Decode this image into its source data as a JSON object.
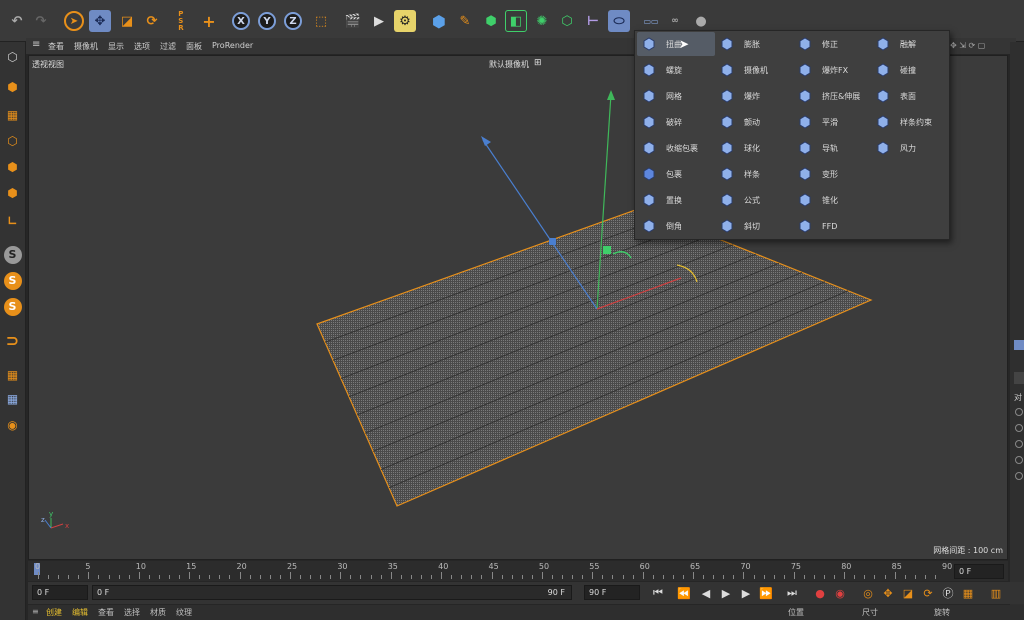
{
  "toolbar": {
    "axis_x": "X",
    "axis_y": "Y",
    "axis_z": "Z"
  },
  "viewport": {
    "menu": [
      "查看",
      "摄像机",
      "显示",
      "选项",
      "过滤",
      "面板",
      "ProRender"
    ],
    "view_name": "透视视图",
    "camera_label": "默认摄像机",
    "grid_spacing": "网格间距 : 100 cm"
  },
  "deformer_menu": {
    "items": [
      {
        "label": "扭曲",
        "icon": "bend-icon",
        "color": "#8fb0ea",
        "highlighted": true
      },
      {
        "label": "螺旋",
        "icon": "twist-icon",
        "color": "#8fb0ea"
      },
      {
        "label": "网格",
        "icon": "mesh-deformer-icon",
        "color": "#8fb0ea"
      },
      {
        "label": "破碎",
        "icon": "shatter-icon",
        "color": "#8fb0ea"
      },
      {
        "label": "收缩包裹",
        "icon": "shrink-wrap-icon",
        "color": "#8fb0ea"
      },
      {
        "label": "包裹",
        "icon": "wrap-icon",
        "color": "#5d86dd"
      },
      {
        "label": "置换",
        "icon": "displacer-icon",
        "color": "#8fb0ea"
      },
      {
        "label": "倒角",
        "icon": "bevel-icon",
        "color": "#8fb0ea"
      },
      {
        "label": "膨胀",
        "icon": "bulge-icon",
        "color": "#8fb0ea"
      },
      {
        "label": "摄像机",
        "icon": "camera-deformer-icon",
        "color": "#8fb0ea"
      },
      {
        "label": "爆炸",
        "icon": "explosion-icon",
        "color": "#8fb0ea"
      },
      {
        "label": "颤动",
        "icon": "jiggle-icon",
        "color": "#8fb0ea"
      },
      {
        "label": "球化",
        "icon": "spherify-icon",
        "color": "#8fb0ea"
      },
      {
        "label": "样条",
        "icon": "spline-deformer-icon",
        "color": "#8fb0ea"
      },
      {
        "label": "公式",
        "icon": "formula-icon",
        "color": "#8fb0ea"
      },
      {
        "label": "斜切",
        "icon": "shear-icon",
        "color": "#8fb0ea"
      },
      {
        "label": "修正",
        "icon": "correction-icon",
        "color": "#8fb0ea"
      },
      {
        "label": "爆炸FX",
        "icon": "explosion-fx-icon",
        "color": "#8fb0ea"
      },
      {
        "label": "挤压&伸展",
        "icon": "squash-stretch-icon",
        "color": "#8fb0ea"
      },
      {
        "label": "平滑",
        "icon": "smoothing-icon",
        "color": "#8fb0ea"
      },
      {
        "label": "导轨",
        "icon": "spline-rail-icon",
        "color": "#8fb0ea"
      },
      {
        "label": "变形",
        "icon": "morph-icon",
        "color": "#8fb0ea"
      },
      {
        "label": "锥化",
        "icon": "taper-icon",
        "color": "#8fb0ea"
      },
      {
        "label": "FFD",
        "icon": "ffd-icon",
        "color": "#8fb0ea"
      },
      {
        "label": "融解",
        "icon": "melt-icon",
        "color": "#8fb0ea"
      },
      {
        "label": "碰撞",
        "icon": "collision-icon",
        "color": "#8fb0ea"
      },
      {
        "label": "表面",
        "icon": "surface-icon",
        "color": "#8fb0ea"
      },
      {
        "label": "样条约束",
        "icon": "spline-wrap-icon",
        "color": "#8fb0ea"
      },
      {
        "label": "风力",
        "icon": "wind-icon",
        "color": "#8fb0ea"
      }
    ]
  },
  "timeline": {
    "ticks": [
      "0",
      "5",
      "10",
      "15",
      "20",
      "25",
      "30",
      "35",
      "40",
      "45",
      "50",
      "55",
      "60",
      "65",
      "70",
      "75",
      "80",
      "85",
      "90"
    ],
    "current_frame": "0 F"
  },
  "controls": {
    "start_frame": "0 F",
    "min_frame": "0 F",
    "max_frame": "90 F",
    "end_frame": "90 F"
  },
  "bottom_menu": [
    "创建",
    "编辑",
    "查看",
    "选择",
    "材质",
    "纹理"
  ],
  "coord_labels": [
    "位置",
    "尺寸",
    "旋转"
  ],
  "right_labels": [
    "对"
  ],
  "colors": {
    "accent_orange": "#e8901a",
    "accent_blue": "#6f8bc4",
    "highlight": "#555c66"
  }
}
